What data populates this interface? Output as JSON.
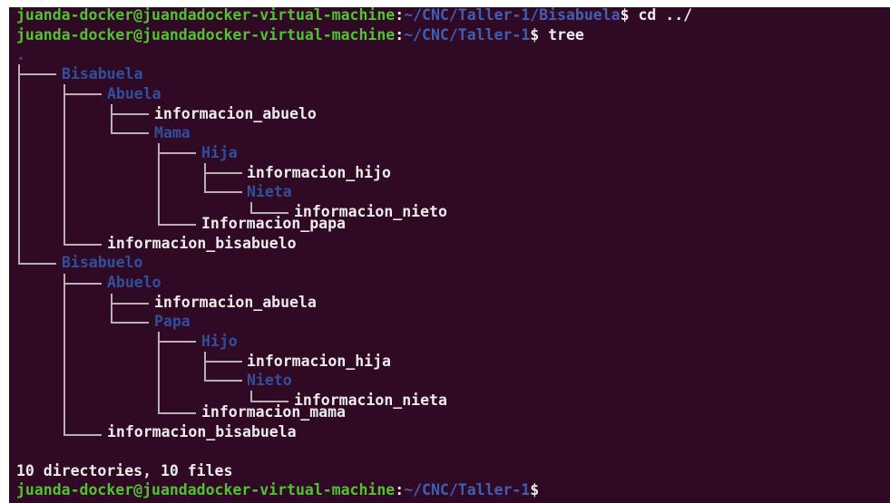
{
  "terminal": {
    "prompt_user_host": "juanda-docker@juandadocker-virtual-machine",
    "prompt_sep": ":",
    "prompt_end": "$",
    "line1": {
      "path": "~/CNC/Taller-1/Bisabuela",
      "command": " cd ../"
    },
    "line2": {
      "path": "~/CNC/Taller-1",
      "command": " tree"
    },
    "root": ".",
    "tree": {
      "bisabuela": "Bisabuela",
      "abuela": "Abuela",
      "informacion_abuelo": "informacion_abuelo",
      "mama": "Mama",
      "hija": "Hija",
      "informacion_hijo": "informacion_hijo",
      "nieta": "Nieta",
      "informacion_nieto": "informacion_nieto",
      "informacion_papa": "Informacion_papa",
      "informacion_bisabuelo": "informacion_bisabuelo",
      "bisabuelo": "Bisabuelo",
      "abuelo": "Abuelo",
      "informacion_abuela": "informacion_abuela",
      "papa": "Papa",
      "hijo": "Hijo",
      "informacion_hija": "informacion_hija",
      "nieto": "Nieto",
      "informacion_nieta": "informacion_nieta",
      "informacion_mama": "informacion_mama",
      "informacion_bisabuela": "informacion_bisabuela"
    },
    "summary": "10 directories, 10 files",
    "line_last": {
      "path": "~/CNC/Taller-1"
    }
  },
  "colors": {
    "background": "#300a24",
    "user_host": "#52c234",
    "path": "#3f5fb3",
    "directory": "#2f4f9f",
    "text": "#ececec"
  }
}
